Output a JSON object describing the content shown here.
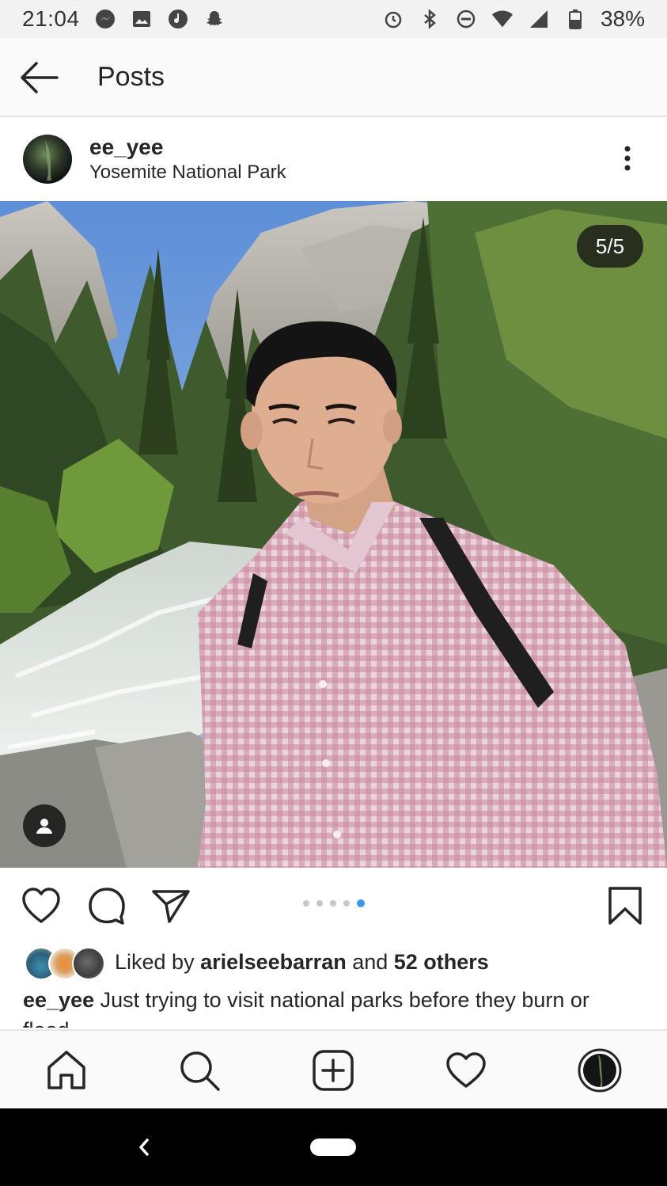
{
  "status_bar": {
    "time": "21:04",
    "battery": "38%",
    "left_icons": [
      "messenger-icon",
      "gallery-icon",
      "music-icon",
      "snapchat-icon"
    ],
    "right_icons": [
      "alarm-icon",
      "bluetooth-icon",
      "do-not-disturb-icon",
      "wifi-icon",
      "signal-icon",
      "battery-icon"
    ]
  },
  "header": {
    "title": "Posts"
  },
  "post": {
    "username": "ee_yee",
    "location": "Yosemite National Park",
    "counter": "5/5",
    "carousel": {
      "total": 5,
      "active": 5
    }
  },
  "likes": {
    "prefix": "Liked by ",
    "user": "arielseebarran",
    "middle": " and ",
    "others": "52 others"
  },
  "caption": {
    "user": "ee_yee",
    "text": " Just trying to visit national parks before they burn or flood"
  },
  "colors": {
    "accent_blue": "#3897f0",
    "text": "#262626"
  }
}
